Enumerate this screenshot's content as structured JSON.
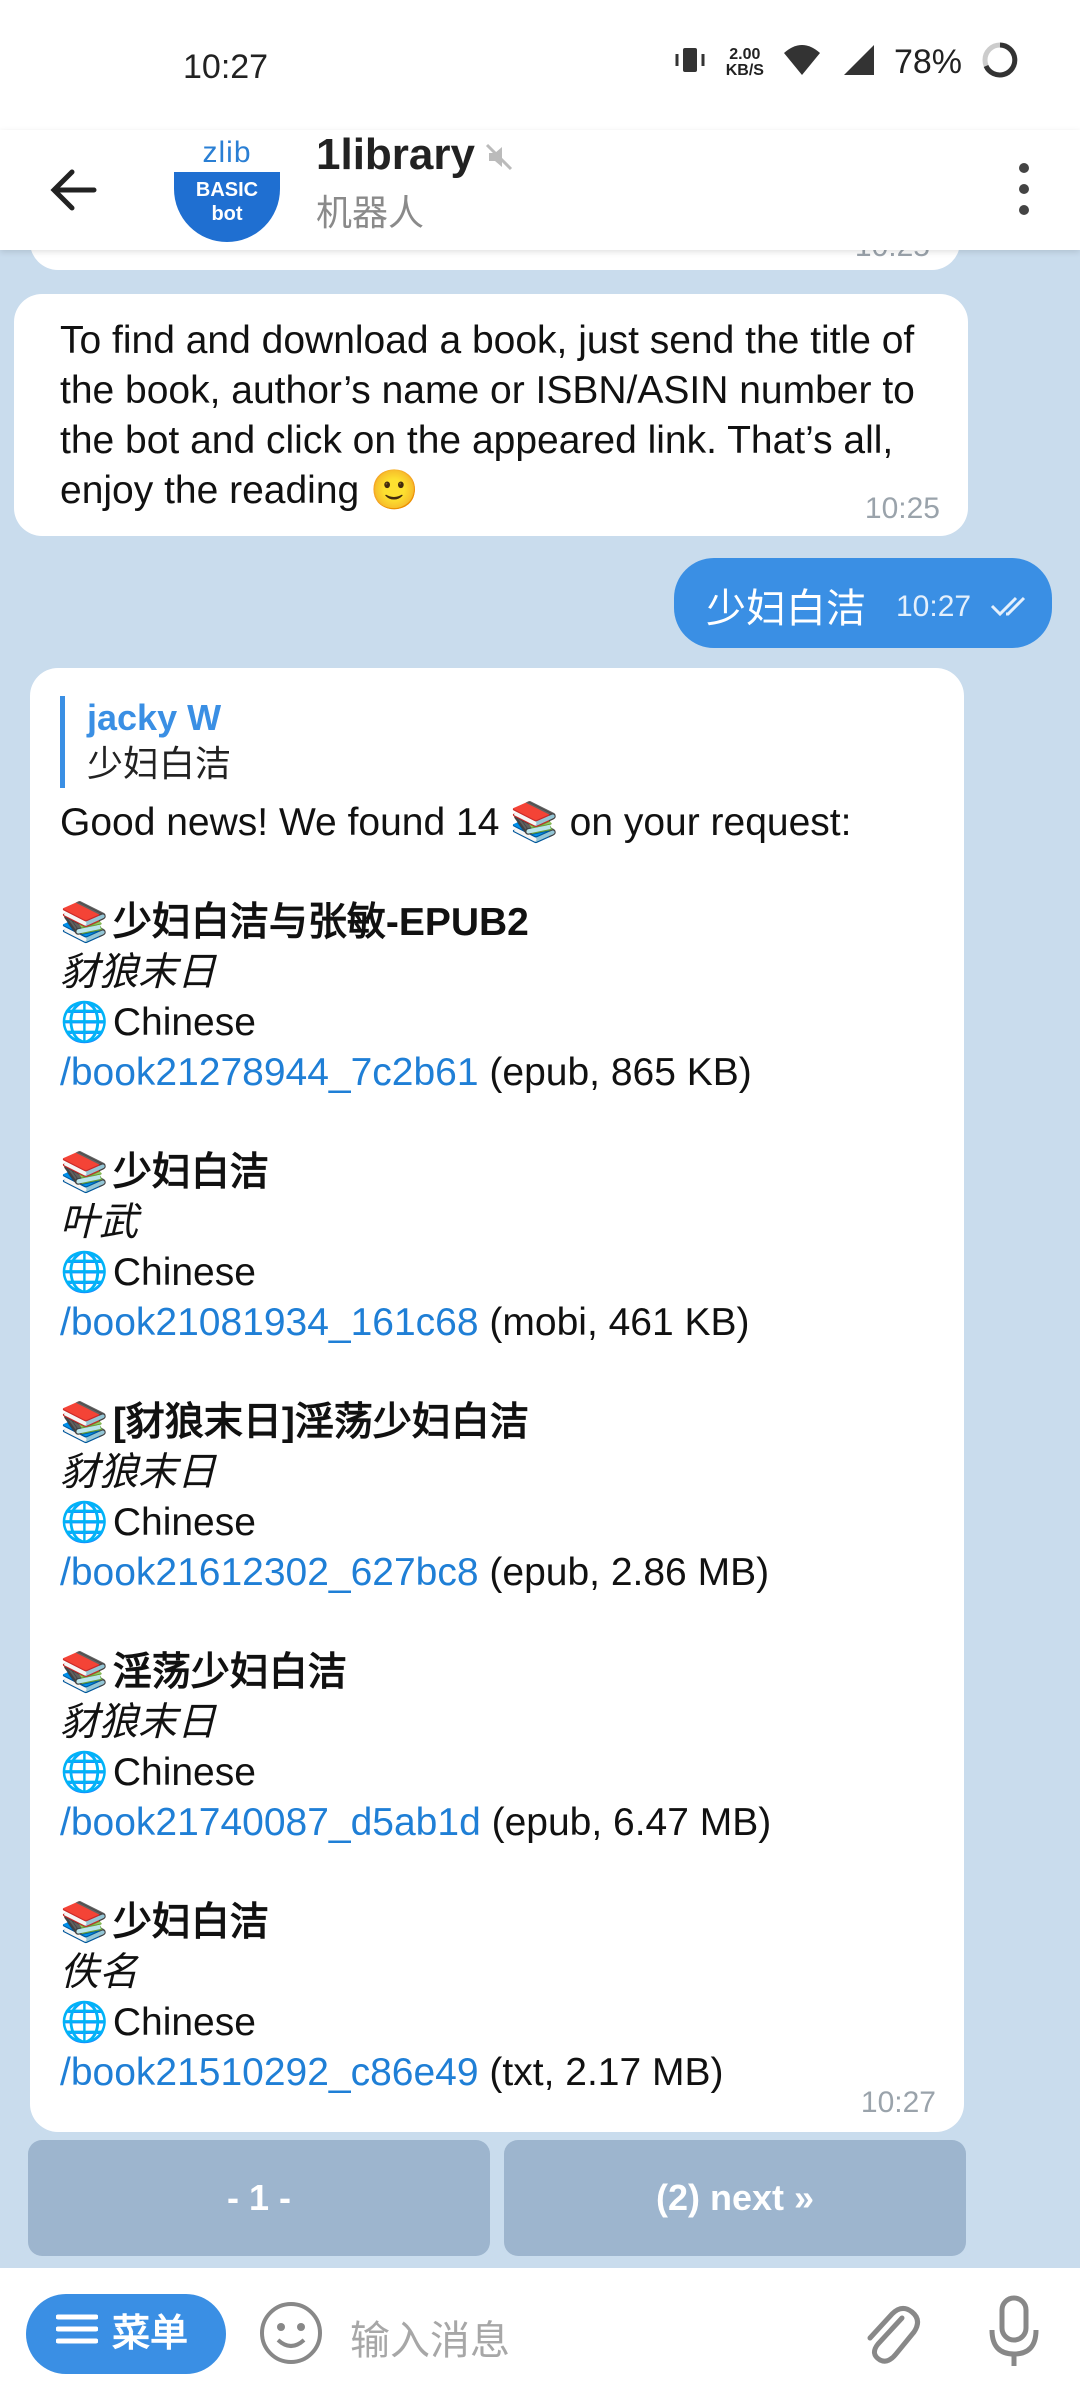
{
  "status_bar": {
    "time": "10:27",
    "net_speed": "2.00",
    "net_unit": "KB/S",
    "battery": "78%"
  },
  "header": {
    "title": "1library",
    "subtitle": "机器人",
    "avatar_top": "zlib",
    "avatar_line1": "BASIC",
    "avatar_line2": "bot"
  },
  "messages": {
    "prev_time": "10:25",
    "intro": {
      "text": "To find and download a book, just send the title of the book, author’s name or ISBN/ASIN number to the bot and click on the appeared link. That’s all, enjoy the reading 🙂",
      "time": "10:25"
    },
    "outgoing": {
      "text": "少妇白洁",
      "time": "10:27"
    },
    "results": {
      "reply_name": "jacky W",
      "reply_text": "少妇白洁",
      "headline": "Good news! We found 14 📚 on your request:",
      "time": "10:27",
      "books": [
        {
          "title": "少妇白洁与张敏-EPUB2",
          "author": "豺狼末日",
          "lang": "Chinese",
          "link": "/book21278944_7c2b61",
          "info": "(epub, 865 KB)"
        },
        {
          "title": "少妇白洁",
          "author": "叶武",
          "lang": "Chinese",
          "link": "/book21081934_161c68",
          "info": "(mobi, 461 KB)"
        },
        {
          "title": "[豺狼末日]淫荡少妇白洁",
          "author": "豺狼末日",
          "lang": "Chinese",
          "link": "/book21612302_627bc8",
          "info": "(epub, 2.86 MB)"
        },
        {
          "title": "淫荡少妇白洁",
          "author": "豺狼末日",
          "lang": "Chinese",
          "link": "/book21740087_d5ab1d",
          "info": "(epub, 6.47 MB)"
        },
        {
          "title": "少妇白洁",
          "author": "佚名",
          "lang": "Chinese",
          "link": "/book21510292_c86e49",
          "info": "(txt, 2.17 MB)"
        }
      ]
    }
  },
  "keyboard": {
    "btn1": "- 1 -",
    "btn2": "(2) next »"
  },
  "input": {
    "menu_label": "菜单",
    "placeholder": "输入消息"
  },
  "icons": {
    "book": "📚",
    "globe": "🌐"
  },
  "colors": {
    "accent": "#3a8fe4",
    "link": "#1f7fd6",
    "chat_bg": "#c9dced"
  }
}
